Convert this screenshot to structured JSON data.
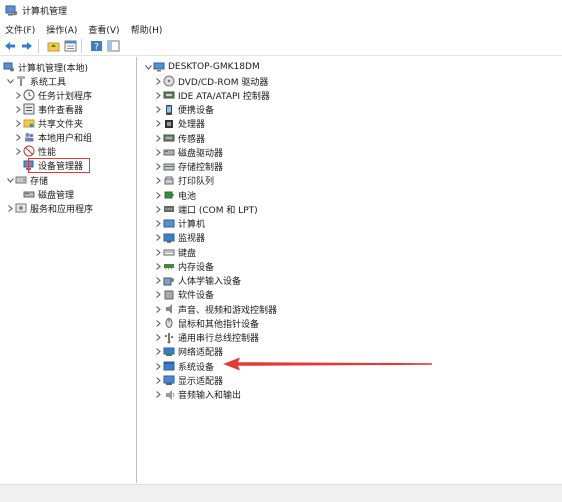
{
  "window": {
    "title": "计算机管理"
  },
  "menu": [
    "文件(F)",
    "操作(A)",
    "查看(V)",
    "帮助(H)"
  ],
  "left_tree": {
    "root": "计算机管理(本地)",
    "system_tools": "系统工具",
    "task_scheduler": "任务计划程序",
    "event_viewer": "事件查看器",
    "shared_folders": "共享文件夹",
    "local_users": "本地用户和组",
    "performance": "性能",
    "device_manager": "设备管理器",
    "storage": "存储",
    "disk_management": "磁盘管理",
    "services_apps": "服务和应用程序"
  },
  "right_tree": {
    "root": "DESKTOP-GMK18DM",
    "items": [
      "DVD/CD-ROM 驱动器",
      "IDE ATA/ATAPI 控制器",
      "便携设备",
      "处理器",
      "传感器",
      "磁盘驱动器",
      "存储控制器",
      "打印队列",
      "电池",
      "端口 (COM 和 LPT)",
      "计算机",
      "监视器",
      "键盘",
      "内存设备",
      "人体学输入设备",
      "软件设备",
      "声音、视频和游戏控制器",
      "鼠标和其他指针设备",
      "通用串行总线控制器",
      "网络适配器",
      "系统设备",
      "显示适配器",
      "音频输入和输出"
    ]
  },
  "colors": {
    "highlight": "#e53935",
    "arrow": "#e53935",
    "icon_blue": "#2b79d0"
  }
}
